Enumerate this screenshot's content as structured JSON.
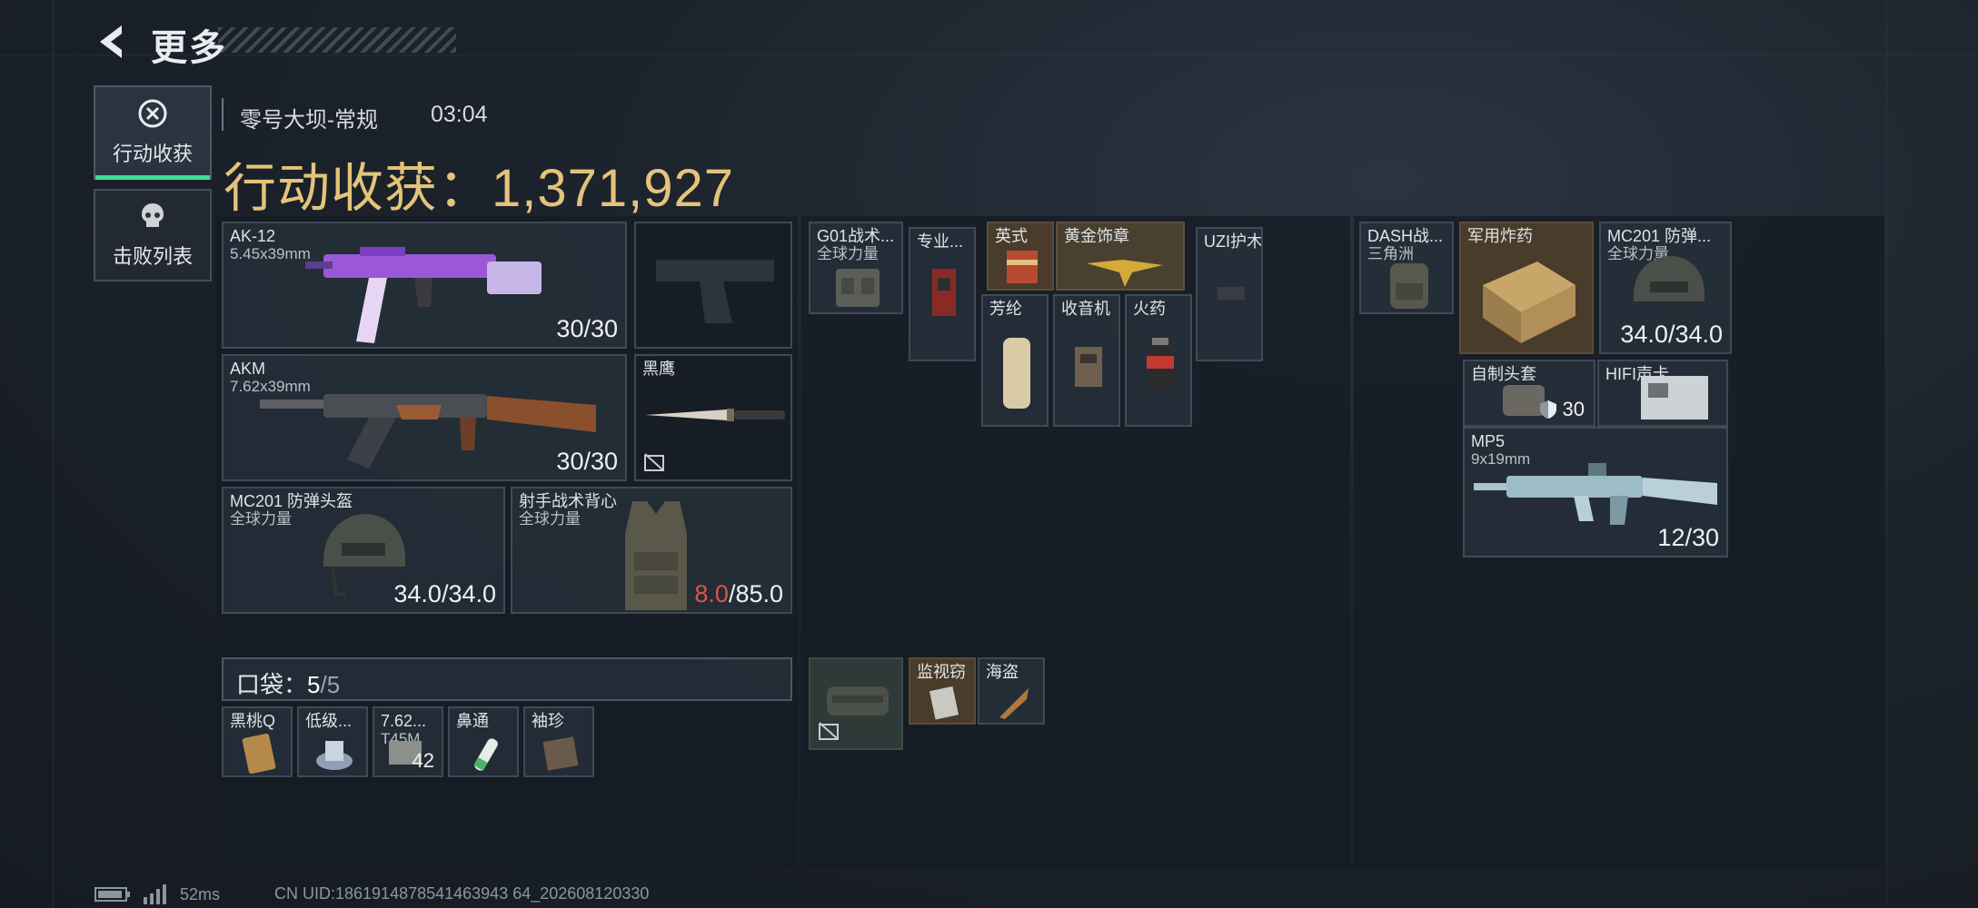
{
  "header": {
    "title": "更多"
  },
  "tabs": [
    {
      "label": "行动收获",
      "icon": "harvest-icon",
      "active": true
    },
    {
      "label": "击败列表",
      "icon": "skull-icon",
      "active": false
    }
  ],
  "summary": {
    "map": "零号大坝-常规",
    "time": "03:04",
    "harvest_label": "行动收获：",
    "harvest_value": "1,371,927"
  },
  "loadout": {
    "primary": {
      "name": "AK-12",
      "ammo_type": "5.45x39mm",
      "ammo": "30/30"
    },
    "secondary": {
      "name": "AKM",
      "ammo_type": "7.62x39mm",
      "ammo": "30/30"
    },
    "pistol": {
      "name": ""
    },
    "melee": {
      "name": "黑鹰"
    },
    "helmet": {
      "name": "MC201 防弹头盔",
      "brand": "全球力量",
      "durability": "34.0/34.0"
    },
    "armor": {
      "name": "射手战术背心",
      "brand": "全球力量",
      "durability_current": "8.0",
      "durability_max": "/85.0"
    }
  },
  "pocket": {
    "label": "口袋：",
    "count": "5",
    "capacity": "/5",
    "items": [
      {
        "name": "黑桃Q",
        "qty": ""
      },
      {
        "name": "低级...",
        "qty": ""
      },
      {
        "name": "7.62...",
        "sub": "T45M",
        "qty": "42"
      },
      {
        "name": "鼻通",
        "qty": ""
      },
      {
        "name": "袖珍",
        "qty": ""
      }
    ]
  },
  "middle": {
    "rig": {
      "name": "G01战术...",
      "brand": "全球力量"
    },
    "items": [
      {
        "name": "专业..."
      },
      {
        "name": "英式"
      },
      {
        "name": "黄金饰章"
      },
      {
        "name": "UZI护木"
      },
      {
        "name": "芳纶"
      },
      {
        "name": "收音机"
      },
      {
        "name": "火药"
      }
    ],
    "safe_items": [
      {
        "name": "监视窃"
      },
      {
        "name": "海盗"
      }
    ]
  },
  "backpack": {
    "bag": {
      "name": "DASH战...",
      "sub": "三角洲"
    },
    "items": [
      {
        "name": "军用炸药"
      },
      {
        "name": "MC201 防弹...",
        "brand": "全球力量",
        "durability": "34.0/34.0"
      },
      {
        "name": "自制头套",
        "value": "30"
      },
      {
        "name": "HIFI声卡"
      },
      {
        "name": "MP5",
        "ammo_type": "9x19mm",
        "ammo": "12/30"
      }
    ]
  },
  "footer": {
    "ping": "52ms",
    "uid": "CN UID:1861914878541463943 64_202608120330"
  }
}
